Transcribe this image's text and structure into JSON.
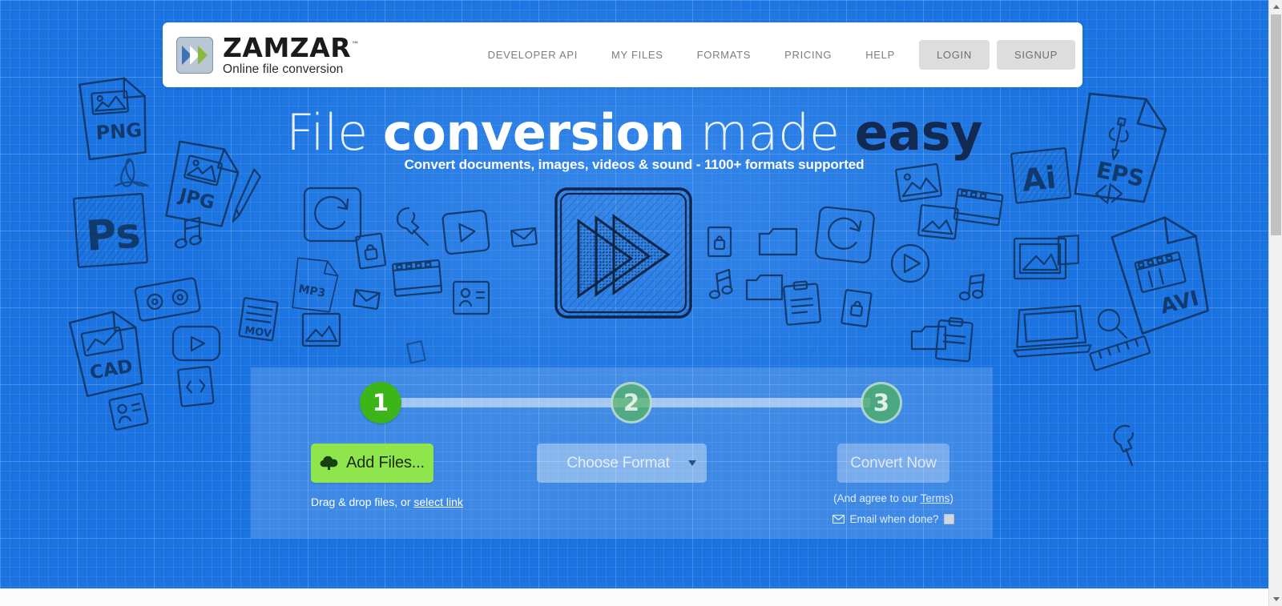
{
  "brand": {
    "name": "ZAMZAR",
    "trademark": "™",
    "tagline": "Online file conversion",
    "logo_icon": "double-chevron-logo-icon",
    "colors": {
      "hero_blue": "#1a73e0",
      "accent_green": "#8ee64c",
      "step_active_green": "#3cb518",
      "headline_dark": "#122a52"
    }
  },
  "nav": {
    "links": [
      {
        "label": "DEVELOPER API",
        "name": "developer-api"
      },
      {
        "label": "MY FILES",
        "name": "my-files"
      },
      {
        "label": "FORMATS",
        "name": "formats"
      },
      {
        "label": "PRICING",
        "name": "pricing"
      },
      {
        "label": "HELP",
        "name": "help"
      }
    ],
    "login_label": "LOGIN",
    "signup_label": "SIGNUP"
  },
  "hero": {
    "headline": {
      "part1": "File ",
      "part2": "conversion",
      "part3": " made ",
      "part4": "easy"
    },
    "subtitle": "Convert documents, images, videos & sound - 1100+ formats supported",
    "center_icon": "fast-forward-sketch-icon"
  },
  "converter": {
    "steps": [
      {
        "number": "1",
        "state": "active"
      },
      {
        "number": "2",
        "state": "inactive"
      },
      {
        "number": "3",
        "state": "inactive"
      }
    ],
    "add_files": {
      "label": "Add Files...",
      "icon": "cloud-upload-icon"
    },
    "drag_note_prefix": "Drag & drop files, or ",
    "select_link_label": "select link",
    "choose_format": {
      "selected": "Choose Format",
      "caret_icon": "chevron-down-icon"
    },
    "convert": {
      "label": "Convert Now",
      "terms_prefix": "(And agree to our ",
      "terms_link_label": "Terms",
      "terms_suffix": ")",
      "email_icon": "envelope-icon",
      "email_label": "Email when done?",
      "email_checked": false
    }
  },
  "doodle_labels": {
    "png": "PNG",
    "jpg": "JPG",
    "ps": "Ps",
    "cad": "CAD",
    "eps": "EPS",
    "ai": "Ai",
    "avi": "AVI"
  },
  "scrollbar": {
    "up_icon": "scroll-up-arrow-icon",
    "down_icon": "scroll-down-arrow-icon"
  }
}
